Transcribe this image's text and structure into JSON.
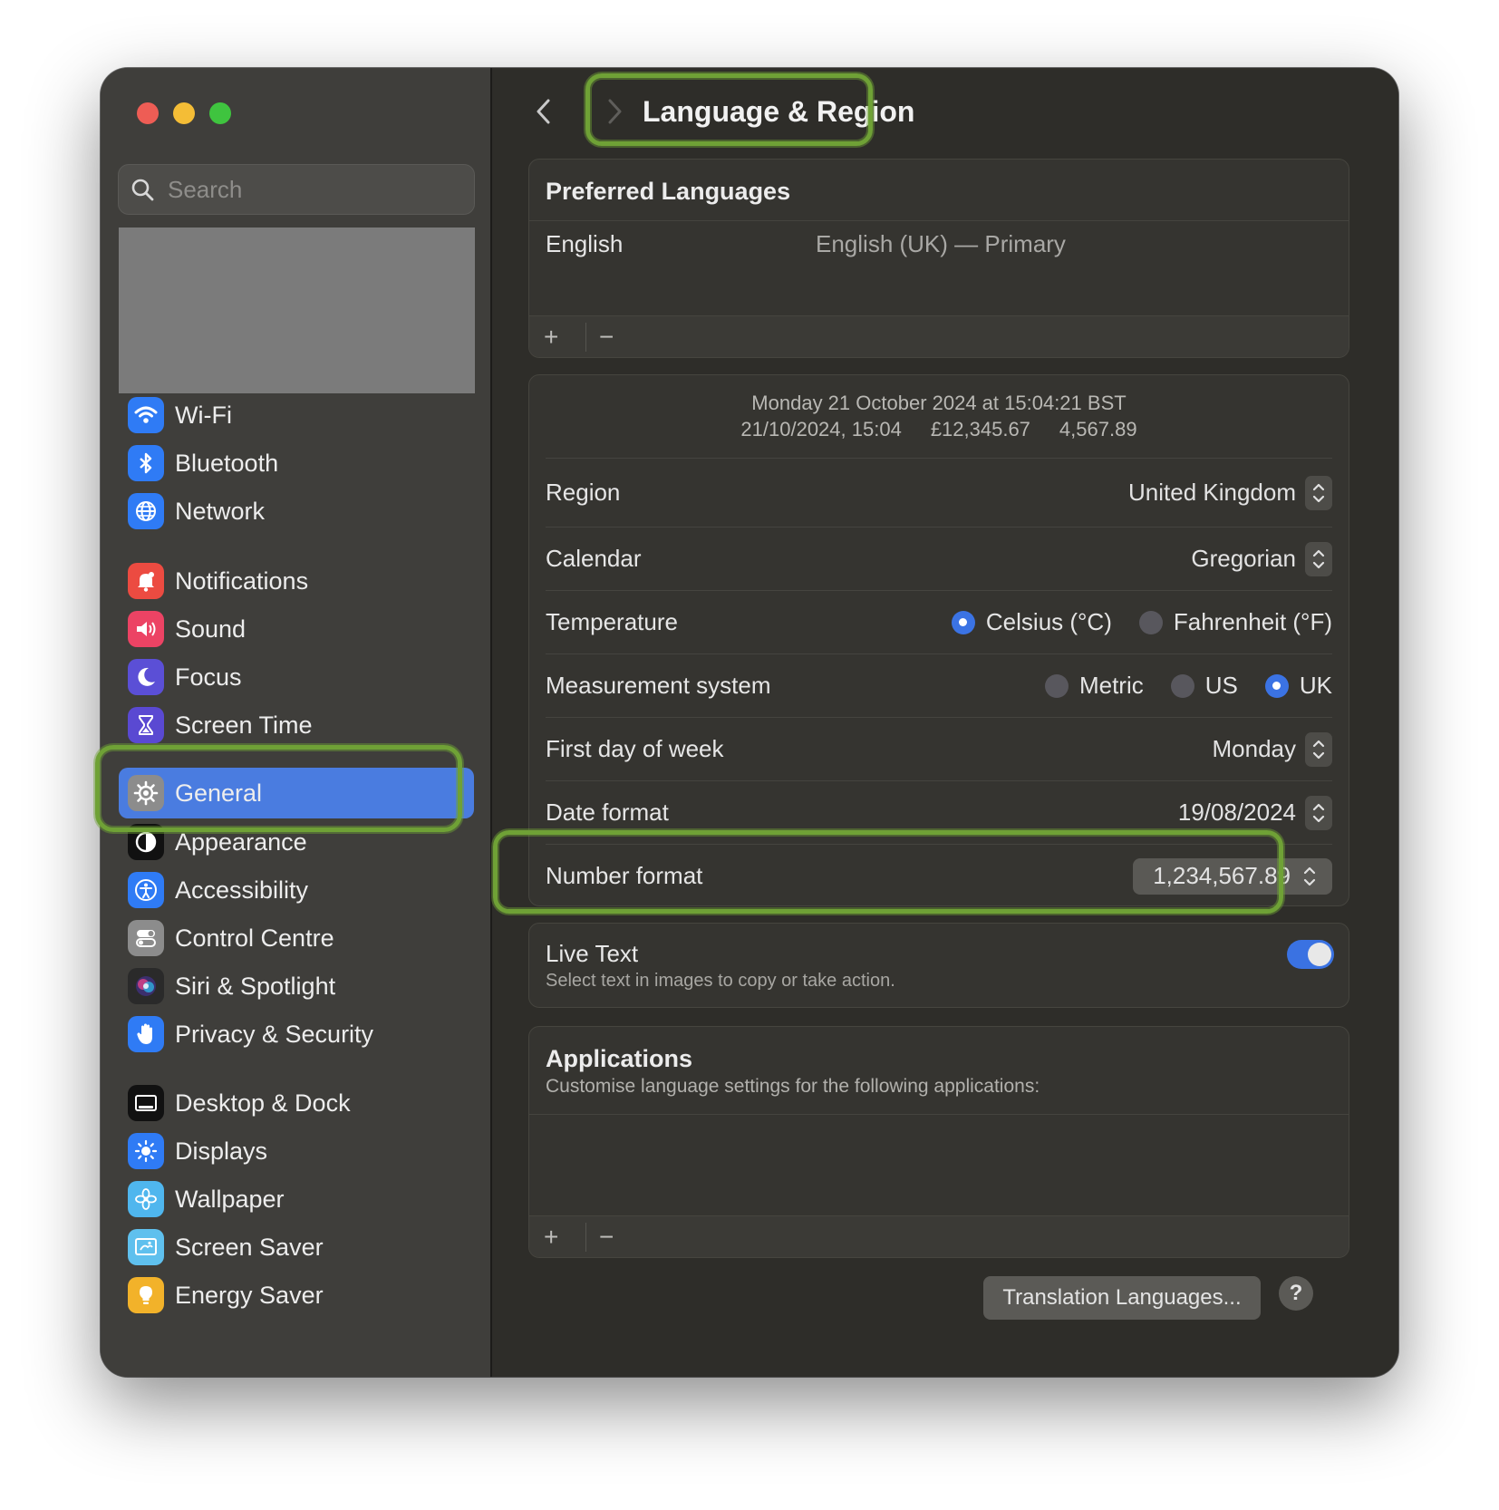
{
  "sidebar": {
    "search_placeholder": "Search",
    "items": [
      {
        "label": "Wi-Fi",
        "icon": "wifi-icon",
        "color": "#2f7bf5"
      },
      {
        "label": "Bluetooth",
        "icon": "bluetooth-icon",
        "color": "#2f7bf5"
      },
      {
        "label": "Network",
        "icon": "globe-icon",
        "color": "#2f7bf5"
      },
      {
        "label": "Notifications",
        "icon": "bell-icon",
        "color": "#ec4b41"
      },
      {
        "label": "Sound",
        "icon": "speaker-icon",
        "color": "#ec4364"
      },
      {
        "label": "Focus",
        "icon": "moon-icon",
        "color": "#5b4fd6"
      },
      {
        "label": "Screen Time",
        "icon": "hourglass-icon",
        "color": "#5a49d2"
      },
      {
        "label": "General",
        "icon": "gear-icon",
        "color": "#8c8c8c"
      },
      {
        "label": "Appearance",
        "icon": "appearance-icon",
        "color": "#111111"
      },
      {
        "label": "Accessibility",
        "icon": "accessibility-icon",
        "color": "#2f7bf5"
      },
      {
        "label": "Control Centre",
        "icon": "toggles-icon",
        "color": "#8c8c8c"
      },
      {
        "label": "Siri & Spotlight",
        "icon": "siri-icon",
        "color": "#2a2a2a"
      },
      {
        "label": "Privacy & Security",
        "icon": "hand-icon",
        "color": "#2f7bf5"
      },
      {
        "label": "Desktop & Dock",
        "icon": "dock-icon",
        "color": "#111111"
      },
      {
        "label": "Displays",
        "icon": "sun-icon",
        "color": "#2f7bf5"
      },
      {
        "label": "Wallpaper",
        "icon": "flower-icon",
        "color": "#4fb6ee"
      },
      {
        "label": "Screen Saver",
        "icon": "screensaver-icon",
        "color": "#5fc0ee"
      },
      {
        "label": "Energy Saver",
        "icon": "bulb-icon",
        "color": "#f2b22a"
      }
    ]
  },
  "header": {
    "title": "Language & Region"
  },
  "preferred_languages": {
    "title": "Preferred Languages",
    "language": "English",
    "detail": "English (UK) — Primary",
    "add": "+",
    "remove": "−"
  },
  "region_preview": {
    "line1": "Monday 21 October 2024 at 15:04:21 BST",
    "date_short": "21/10/2024, 15:04",
    "currency": "£12,345.67",
    "number": "4,567.89"
  },
  "settings": {
    "region": {
      "label": "Region",
      "value": "United Kingdom"
    },
    "calendar": {
      "label": "Calendar",
      "value": "Gregorian"
    },
    "temperature": {
      "label": "Temperature",
      "options": [
        "Celsius (°C)",
        "Fahrenheit (°F)"
      ],
      "selected": "Celsius (°C)"
    },
    "measurement": {
      "label": "Measurement system",
      "options": [
        "Metric",
        "US",
        "UK"
      ],
      "selected": "UK"
    },
    "first_day": {
      "label": "First day of week",
      "value": "Monday"
    },
    "date_format": {
      "label": "Date format",
      "value": "19/08/2024"
    },
    "number_format": {
      "label": "Number format",
      "value": "1,234,567.89"
    }
  },
  "live_text": {
    "title": "Live Text",
    "description": "Select text in images to copy or take action.",
    "enabled": true
  },
  "applications": {
    "title": "Applications",
    "description": "Customise language settings for the following applications:",
    "add": "+",
    "remove": "−"
  },
  "footer": {
    "translation_button": "Translation Languages...",
    "help_button": "?"
  },
  "colors": {
    "accent": "#4a7ce0",
    "highlight": "#6fa136"
  }
}
